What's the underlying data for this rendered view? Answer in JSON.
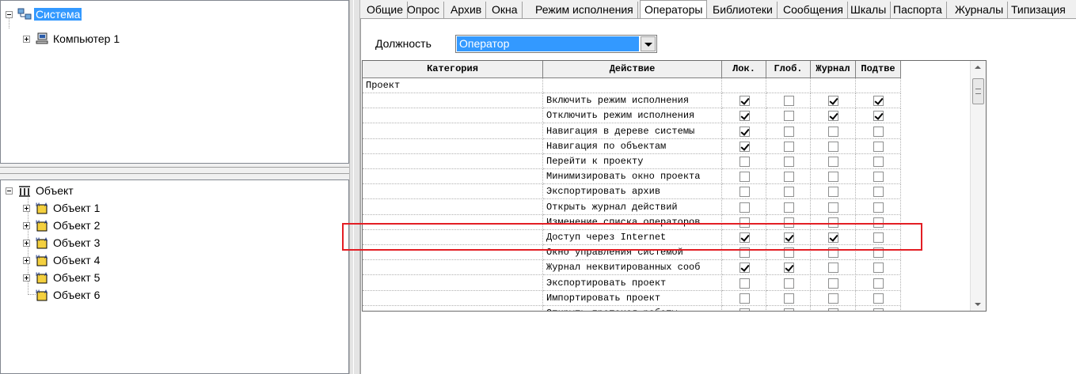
{
  "tree_top": {
    "root_label": "Система",
    "child_label": "Компьютер 1"
  },
  "tree_bottom": {
    "root_label": "Объект",
    "items": [
      "Объект 1",
      "Объект 2",
      "Объект 3",
      "Объект 4",
      "Объект 5",
      "Объект 6"
    ]
  },
  "tabs": [
    "Общие",
    "Опрос",
    "Архив",
    "Окна",
    "Режим исполнения",
    "Операторы",
    "Библиотеки",
    "Сообщения",
    "Шкалы",
    "Паспорта",
    "Журналы",
    "Типизация"
  ],
  "active_tab": "Операторы",
  "role": {
    "label": "Должность",
    "value": "Оператор"
  },
  "grid": {
    "headers": [
      "Категория",
      "Действие",
      "Лок.",
      "Глоб.",
      "Журнал",
      "Подтве"
    ],
    "rows": [
      {
        "category": "Проект",
        "action": "",
        "lok": null,
        "glob": null,
        "journal": null,
        "confirm": null
      },
      {
        "category": "",
        "action": "Включить режим исполнения",
        "lok": true,
        "glob": false,
        "journal": true,
        "confirm": true
      },
      {
        "category": "",
        "action": "Отключить режим исполнения",
        "lok": true,
        "glob": false,
        "journal": true,
        "confirm": true
      },
      {
        "category": "",
        "action": "Навигация в дереве системы",
        "lok": true,
        "glob": false,
        "journal": false,
        "confirm": false
      },
      {
        "category": "",
        "action": "Навигация по объектам",
        "lok": true,
        "glob": false,
        "journal": false,
        "confirm": false
      },
      {
        "category": "",
        "action": "Перейти к проекту",
        "lok": false,
        "glob": false,
        "journal": false,
        "confirm": false
      },
      {
        "category": "",
        "action": "Минимизировать окно проекта",
        "lok": false,
        "glob": false,
        "journal": false,
        "confirm": false
      },
      {
        "category": "",
        "action": "Экспортировать архив",
        "lok": false,
        "glob": false,
        "journal": false,
        "confirm": false
      },
      {
        "category": "",
        "action": "Открыть журнал действий",
        "lok": false,
        "glob": false,
        "journal": false,
        "confirm": false
      },
      {
        "category": "",
        "action": "Изменение списка операторов",
        "lok": false,
        "glob": false,
        "journal": false,
        "confirm": false
      },
      {
        "category": "",
        "action": "Доступ через Internet",
        "lok": true,
        "glob": true,
        "journal": true,
        "confirm": false
      },
      {
        "category": "",
        "action": "Окно управления системой",
        "lok": false,
        "glob": false,
        "journal": false,
        "confirm": false
      },
      {
        "category": "",
        "action": "Журнал неквитированных сооб",
        "lok": true,
        "glob": true,
        "journal": false,
        "confirm": false
      },
      {
        "category": "",
        "action": "Экспортировать проект",
        "lok": false,
        "glob": false,
        "journal": false,
        "confirm": false
      },
      {
        "category": "",
        "action": "Импортировать проект",
        "lok": false,
        "glob": false,
        "journal": false,
        "confirm": false
      },
      {
        "category": "",
        "action": "Открыть протокол работы",
        "lok": false,
        "glob": false,
        "journal": false,
        "confirm": false
      }
    ]
  },
  "colors": {
    "selection": "#3399ff",
    "highlight_box": "#e31e24"
  }
}
